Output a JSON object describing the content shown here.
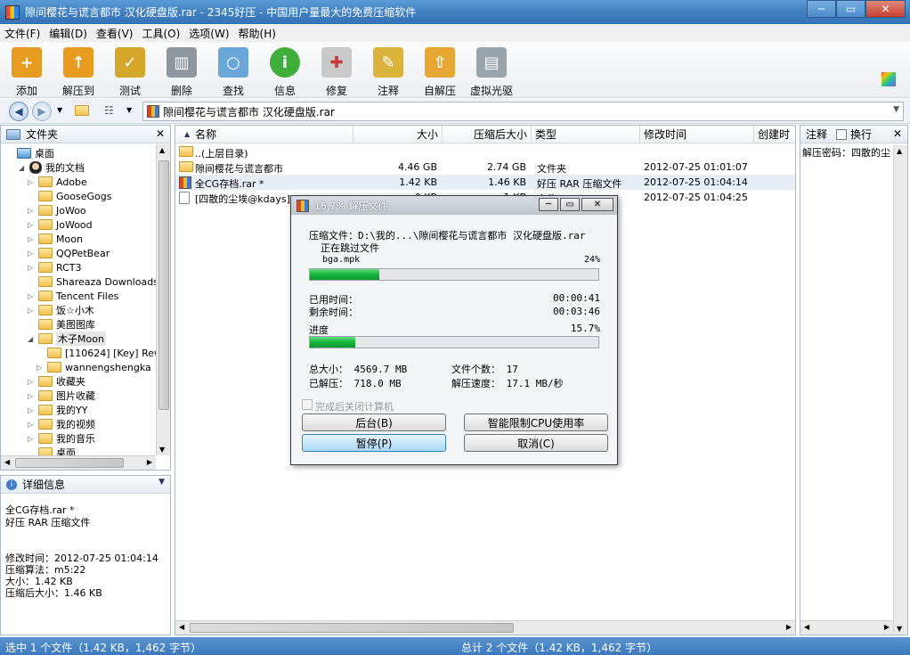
{
  "window": {
    "title": "隙间樱花与谎言都市 汉化硬盘版.rar - 2345好压 - 中国用户量最大的免费压缩软件",
    "min": "─",
    "max": "▭",
    "close": "✕"
  },
  "menu": [
    "文件(F)",
    "编辑(D)",
    "查看(V)",
    "工具(O)",
    "选项(W)",
    "帮助(H)"
  ],
  "toolbar": [
    {
      "label": "添加",
      "icon": "add-icon",
      "color": "#e79b1f"
    },
    {
      "label": "解压到",
      "icon": "extract-to-icon",
      "color": "#e79b1f"
    },
    {
      "label": "测试",
      "icon": "test-icon",
      "color": "#d4a62a"
    },
    {
      "label": "删除",
      "icon": "delete-icon",
      "color": "#8e969e"
    },
    {
      "label": "查找",
      "icon": "find-icon",
      "color": "#6aa7d8"
    },
    {
      "label": "信息",
      "icon": "info-icon",
      "color": "#3fae3a"
    },
    {
      "label": "修复",
      "icon": "repair-icon",
      "color": "#c9c9c9"
    },
    {
      "label": "注释",
      "icon": "comment-icon",
      "color": "#d9b33b"
    },
    {
      "label": "自解压",
      "icon": "sfx-icon",
      "color": "#e7a833"
    },
    {
      "label": "虚拟光驱",
      "icon": "virtual-drive-icon",
      "color": "#9aa4ad"
    }
  ],
  "address": {
    "path": "隙间樱花与谎言都市 汉化硬盘版.rar"
  },
  "folderpane": {
    "title": "文件夹",
    "close": "✕"
  },
  "tree": [
    {
      "label": "桌面",
      "indent": 0,
      "exp": ""
    },
    {
      "label": "我的文档",
      "indent": 1,
      "exp": "◢"
    },
    {
      "label": "Adobe",
      "indent": 2,
      "exp": "▷"
    },
    {
      "label": "GooseGogs",
      "indent": 2,
      "exp": ""
    },
    {
      "label": "JoWoo",
      "indent": 2,
      "exp": "▷"
    },
    {
      "label": "JoWood",
      "indent": 2,
      "exp": "▷"
    },
    {
      "label": "Moon",
      "indent": 2,
      "exp": "▷"
    },
    {
      "label": "QQPetBear",
      "indent": 2,
      "exp": "▷"
    },
    {
      "label": "RCT3",
      "indent": 2,
      "exp": "▷"
    },
    {
      "label": "Shareaza Downloads",
      "indent": 2,
      "exp": ""
    },
    {
      "label": "Tencent Files",
      "indent": 2,
      "exp": "▷"
    },
    {
      "label": "饭☆小木",
      "indent": 2,
      "exp": "▷"
    },
    {
      "label": "美图图库",
      "indent": 2,
      "exp": ""
    },
    {
      "label": "木子Moon",
      "indent": 2,
      "exp": "◢"
    },
    {
      "label": "[110624] [Key] Rew",
      "indent": 3,
      "exp": ""
    },
    {
      "label": "wannengshengka",
      "indent": 3,
      "exp": "▷"
    },
    {
      "label": "收藏夹",
      "indent": 2,
      "exp": "▷"
    },
    {
      "label": "图片收藏",
      "indent": 2,
      "exp": "▷"
    },
    {
      "label": "我的YY",
      "indent": 2,
      "exp": "▷"
    },
    {
      "label": "我的视频",
      "indent": 2,
      "exp": "▷"
    },
    {
      "label": "我的音乐",
      "indent": 2,
      "exp": "▷"
    },
    {
      "label": "桌面",
      "indent": 2,
      "exp": ""
    }
  ],
  "details": {
    "title": "详细信息",
    "name": "全CG存档.rar *",
    "type": "好压 RAR 压缩文件",
    "mtime": "修改时间：2012-07-25 01:04:14",
    "algo": "压缩算法：m5:22",
    "size": "大小：1.42 KB",
    "packed": "压缩后大小：1.46 KB"
  },
  "columns": [
    "名称",
    "大小",
    "压缩后大小",
    "类型",
    "修改时间",
    "创建时"
  ],
  "files": [
    {
      "name": "..(上层目录)",
      "size": "",
      "packed": "",
      "type": "",
      "mtime": "",
      "icon": "folder"
    },
    {
      "name": "隙间樱花与谎言都市",
      "size": "4.46 GB",
      "packed": "2.74 GB",
      "type": "文件夹",
      "mtime": "2012-07-25 01:01:07",
      "icon": "folder"
    },
    {
      "name": "全CG存档.rar *",
      "size": "1.42 KB",
      "packed": "1.46 KB",
      "type": "好压 RAR 压缩文件",
      "mtime": "2012-07-25 01:04:14",
      "icon": "rar"
    },
    {
      "name": "[四散的尘埃@kdays] *",
      "size": "0 KB",
      "packed": "1 KB",
      "type": "文件",
      "mtime": "2012-07-25 01:04:25",
      "icon": "file"
    }
  ],
  "commentpane": {
    "title": "注释",
    "wrap": "换行",
    "close": "✕",
    "text": "解压密码：四散的尘"
  },
  "dialog": {
    "title": "15.7% 解压文件",
    "archive": "压缩文件：D:\\我的...\\隙间樱花与谎言都市 汉化硬盘版.rar",
    "status": "正在跳过文件",
    "current_file": "bga.mpk",
    "file_percent": "24%",
    "file_progress": 0.24,
    "elapsed_label": "已用时间：",
    "elapsed": "00:00:41",
    "remaining_label": "剩余时间：",
    "remaining": "00:03:46",
    "progress_label": "进度",
    "progress_percent": "15.7%",
    "progress": 0.157,
    "total_size": "总大小： 4569.7 MB",
    "file_count": "文件个数： 17",
    "extracted": "已解压： 718.0 MB",
    "speed": "解压速度： 17.1 MB/秒",
    "shutdown": "完成后关闭计算机",
    "btn_background": "后台(B)",
    "btn_cpu": "智能限制CPU使用率",
    "btn_pause": "暂停(P)",
    "btn_cancel": "取消(C)"
  },
  "status": {
    "left": "选中 1 个文件（1.42 KB，1,462 字节）",
    "right": "总计 2 个文件（1.42 KB，1,462 字节）"
  }
}
